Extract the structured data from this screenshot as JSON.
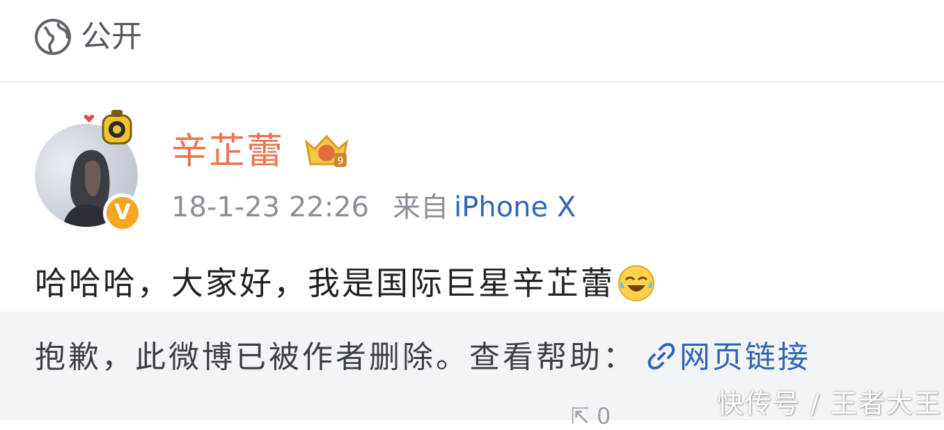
{
  "visibility": {
    "icon": "globe-icon",
    "label": "公开"
  },
  "post": {
    "author": {
      "name": "辛芷蕾",
      "avatar": "avatar",
      "verified_icon": "verified-v-icon",
      "member_badge_icon": "vip-crown-badge-icon",
      "member_level": "9"
    },
    "meta": {
      "time": "18-1-23 22:26",
      "from_label": "来自",
      "source": "iPhone X"
    },
    "text": "哈哈哈，大家好，我是国际巨星辛芷蕾",
    "emoji": "laughing-crying-emoji"
  },
  "deleted_notice": {
    "message": "抱歉，此微博已被作者删除。查看帮助：",
    "link_icon": "link-icon",
    "link_text": "网页链接"
  },
  "footer": {
    "repost_count": "0",
    "repost_icon": "repost-icon"
  },
  "watermark": "快传号 / 王者大王",
  "colors": {
    "username": "#eb7350",
    "link": "#2f66b4",
    "deleted_bg": "#f3f4f6",
    "badge": "#f5a623"
  }
}
